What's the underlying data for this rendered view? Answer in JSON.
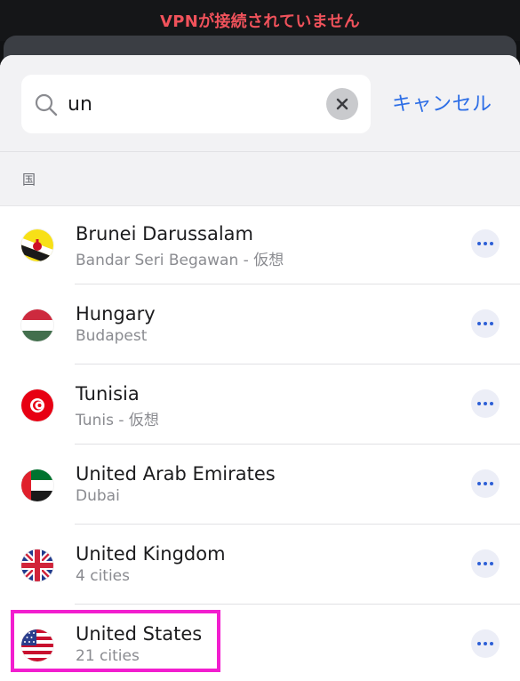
{
  "status": {
    "vpn_text": "VPNが接続されていません",
    "color": "#f0525b"
  },
  "search": {
    "value": "un",
    "cancel_label": "キャンセル"
  },
  "section": {
    "label": "国"
  },
  "countries": [
    {
      "name": "Brunei Darussalam",
      "subtitle": "Bandar Seri Begawan - 仮想",
      "flag": "brunei-flag-icon"
    },
    {
      "name": "Hungary",
      "subtitle": "Budapest",
      "flag": "hungary-flag-icon"
    },
    {
      "name": "Tunisia",
      "subtitle": "Tunis - 仮想",
      "flag": "tunisia-flag-icon"
    },
    {
      "name": "United Arab Emirates",
      "subtitle": "Dubai",
      "flag": "uae-flag-icon"
    },
    {
      "name": "United Kingdom",
      "subtitle": "4 cities",
      "flag": "uk-flag-icon"
    },
    {
      "name": "United States",
      "subtitle": "21 cities",
      "flag": "us-flag-icon"
    }
  ],
  "colors": {
    "accent": "#2d6ee6",
    "highlight": "#f21ecf"
  }
}
